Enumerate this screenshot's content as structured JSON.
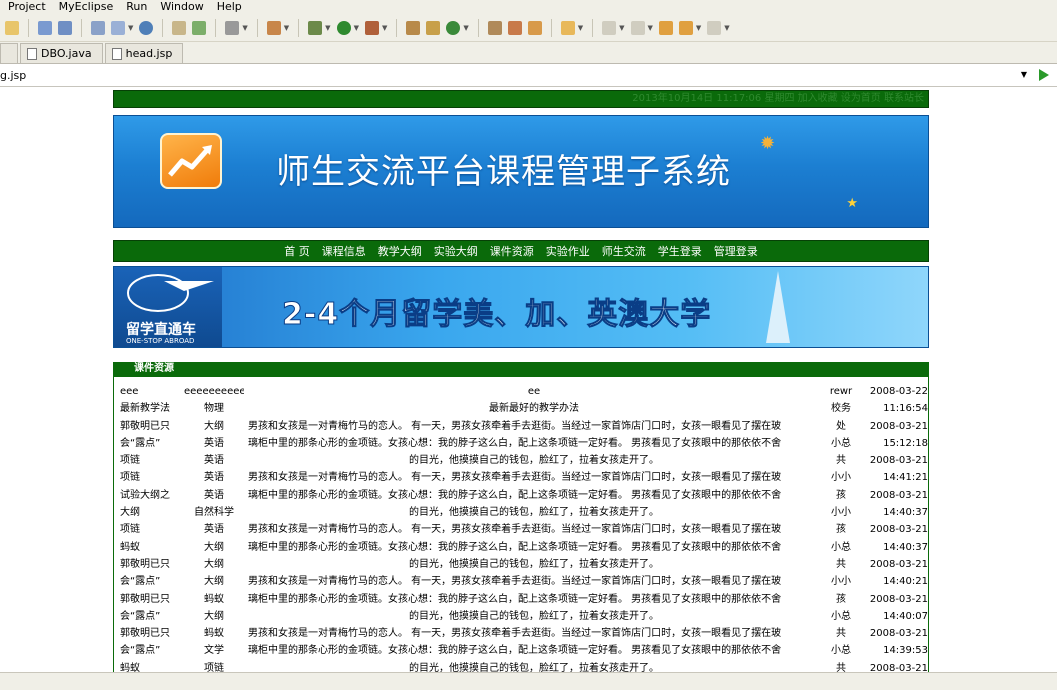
{
  "menu": [
    "Project",
    "MyEclipse",
    "Run",
    "Window",
    "Help"
  ],
  "tabs": [
    {
      "label": "DBO.java"
    },
    {
      "label": "head.jsp"
    }
  ],
  "url": {
    "value": "g.jsp"
  },
  "site": {
    "topbar": "2013年10月14日 11:17:06 星期四 加入收藏 设为首页 联系站长",
    "banner_title": "师生交流平台课程管理子系统",
    "nav": [
      "首 页",
      "课程信息",
      "教学大纲",
      "实验大纲",
      "课件资源",
      "实验作业",
      "师生交流",
      "学生登录",
      "管理登录"
    ],
    "ad_logo_text": "留学直通车",
    "ad_logo_sub": "ONE-STOP ABROAD",
    "ad_title": "2-4个月留学美、加、英澳大学",
    "panel_title": "课件资源"
  },
  "colors": {
    "green": "#0a6a0a",
    "banner_blue": "#1c7fd2"
  },
  "rows": [
    {
      "title": "eee",
      "cat": "eeeeeeeeeee",
      "content": "ee",
      "center": true,
      "author": "rewr",
      "date": "2008-03-22"
    },
    {
      "title": "最新教学法",
      "cat": "物理",
      "content": "最新最好的教学办法",
      "center": true,
      "author": "校务",
      "date": "11:16:54"
    },
    {
      "title": "郭敬明已只",
      "cat": "大纲",
      "content": "男孩和女孩是一对青梅竹马的恋人。 有一天，男孩女孩牵着手去逛街。当经过一家首饰店门口时，女孩一眼看见了摆在玻",
      "center": false,
      "author": "处",
      "date": "2008-03-21"
    },
    {
      "title": "会“露点”",
      "cat": "英语",
      "content": "璃柜中里的那条心形的金项链。女孩心想：我的脖子这么白，配上这条项链一定好看。 男孩看见了女孩眼中的那依依不舍",
      "center": false,
      "author": "小总",
      "date": "15:12:18"
    },
    {
      "title": "项链",
      "cat": "英语",
      "content": "的目光，他摸摸自己的钱包，脸红了，拉着女孩走开了。",
      "center": true,
      "author": "共",
      "date": "2008-03-21"
    },
    {
      "title": "项链",
      "cat": "英语",
      "content": "男孩和女孩是一对青梅竹马的恋人。 有一天，男孩女孩牵着手去逛街。当经过一家首饰店门口时，女孩一眼看见了摆在玻",
      "center": false,
      "author": "小小",
      "date": "14:41:21"
    },
    {
      "title": "试验大纲之",
      "cat": "英语",
      "content": "璃柜中里的那条心形的金项链。女孩心想：我的脖子这么白，配上这条项链一定好看。 男孩看见了女孩眼中的那依依不舍",
      "center": false,
      "author": "孩",
      "date": "2008-03-21"
    },
    {
      "title": "大纲",
      "cat": "自然科学",
      "content": "的目光，他摸摸自己的钱包，脸红了，拉着女孩走开了。",
      "center": true,
      "author": "小小",
      "date": "14:40:37"
    },
    {
      "title": "项链",
      "cat": "英语",
      "content": "男孩和女孩是一对青梅竹马的恋人。 有一天，男孩女孩牵着手去逛街。当经过一家首饰店门口时，女孩一眼看见了摆在玻",
      "center": false,
      "author": "孩",
      "date": "2008-03-21"
    },
    {
      "title": "蚂蚁",
      "cat": "大纲",
      "content": "璃柜中里的那条心形的金项链。女孩心想：我的脖子这么白，配上这条项链一定好看。 男孩看见了女孩眼中的那依依不舍",
      "center": false,
      "author": "小总",
      "date": "14:40:37"
    },
    {
      "title": "郭敬明已只",
      "cat": "大纲",
      "content": "的目光，他摸摸自己的钱包，脸红了，拉着女孩走开了。",
      "center": true,
      "author": "共",
      "date": "2008-03-21"
    },
    {
      "title": "会“露点”",
      "cat": "大纲",
      "content": "男孩和女孩是一对青梅竹马的恋人。 有一天，男孩女孩牵着手去逛街。当经过一家首饰店门口时，女孩一眼看见了摆在玻",
      "center": false,
      "author": "小小",
      "date": "14:40:21"
    },
    {
      "title": "郭敬明已只",
      "cat": "蚂蚁",
      "content": "璃柜中里的那条心形的金项链。女孩心想：我的脖子这么白，配上这条项链一定好看。 男孩看见了女孩眼中的那依依不舍",
      "center": false,
      "author": "孩",
      "date": "2008-03-21"
    },
    {
      "title": "会“露点”",
      "cat": "大纲",
      "content": "的目光，他摸摸自己的钱包，脸红了，拉着女孩走开了。",
      "center": true,
      "author": "小总",
      "date": "14:40:07"
    },
    {
      "title": "郭敬明已只",
      "cat": "蚂蚁",
      "content": "男孩和女孩是一对青梅竹马的恋人。 有一天，男孩女孩牵着手去逛街。当经过一家首饰店门口时，女孩一眼看见了摆在玻",
      "center": false,
      "author": "共",
      "date": "2008-03-21"
    },
    {
      "title": "会“露点”",
      "cat": "文学",
      "content": "璃柜中里的那条心形的金项链。女孩心想：我的脖子这么白，配上这条项链一定好看。 男孩看见了女孩眼中的那依依不舍",
      "center": false,
      "author": "小总",
      "date": "14:39:53"
    },
    {
      "title": "蚂蚁",
      "cat": "项链",
      "content": "的目光，他摸摸自己的钱包，脸红了，拉着女孩走开了。",
      "center": true,
      "author": "共",
      "date": "2008-03-21"
    }
  ]
}
